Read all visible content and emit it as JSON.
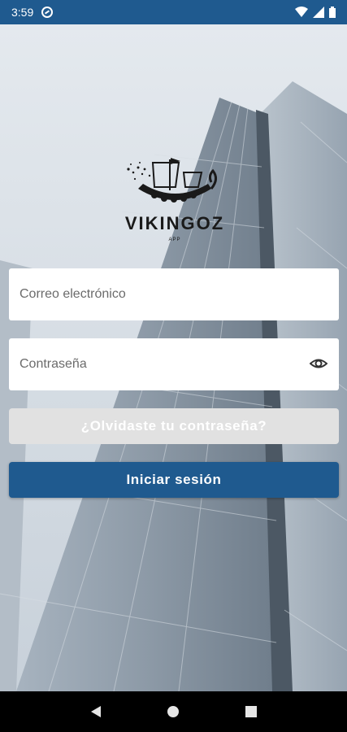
{
  "status_bar": {
    "time": "3:59",
    "sync_icon": "data-sync-icon",
    "wifi_icon": "wifi-icon",
    "signal_icon": "signal-icon",
    "battery_icon": "battery-icon"
  },
  "logo": {
    "title": "VIKINGOZ",
    "subtitle": "APP"
  },
  "form": {
    "email_placeholder": "Correo electrónico",
    "password_placeholder": "Contraseña",
    "eye_icon": "eye-icon",
    "forgot_label": "¿Olvidaste tu contraseña?",
    "login_label": "Iniciar sesión"
  },
  "nav_bar": {
    "back_icon": "back-icon",
    "home_icon": "home-icon",
    "recents_icon": "recents-icon"
  },
  "colors": {
    "primary": "#1f5a8f",
    "forgot_bg": "#e1e1e1",
    "field_bg": "#ffffff"
  }
}
